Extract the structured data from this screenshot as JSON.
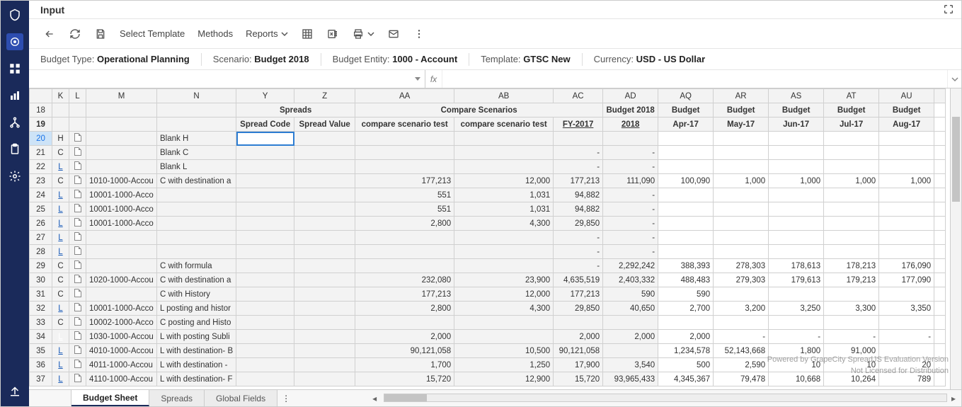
{
  "title": "Input",
  "toolbar": {
    "select_template": "Select Template",
    "methods": "Methods",
    "reports": "Reports"
  },
  "context": {
    "budget_type_label": "Budget Type:",
    "budget_type_value": "Operational Planning",
    "scenario_label": "Scenario:",
    "scenario_value": "Budget 2018",
    "entity_label": "Budget Entity:",
    "entity_value": "1000 - Account",
    "template_label": "Template:",
    "template_value": "GTSC New",
    "currency_label": "Currency:",
    "currency_value": "USD - US Dollar"
  },
  "formula": {
    "fx": "fx",
    "value": ""
  },
  "columns": [
    "K",
    "L",
    "M",
    "N",
    "Y",
    "Z",
    "AA",
    "AB",
    "AC",
    "AD",
    "AQ",
    "AR",
    "AS",
    "AT",
    "AU"
  ],
  "group_row": {
    "spreads": "Spreads",
    "compare": "Compare Scenarios",
    "budget_2018": "Budget 2018",
    "budget": "Budget"
  },
  "header_row": {
    "spread_code": "Spread Code",
    "spread_value": "Spread Value",
    "cst1": "compare scenario test",
    "cst2": "compare scenario test",
    "fy2017": "FY-2017",
    "y2018": "2018",
    "apr17": "Apr-17",
    "may17": "May-17",
    "jun17": "Jun-17",
    "jul17": "Jul-17",
    "aug17": "Aug-17"
  },
  "rows": [
    {
      "n": 20,
      "K": "H",
      "N": "Blank H"
    },
    {
      "n": 21,
      "K": "C",
      "N": "Blank C",
      "AC": "-",
      "AD": "-"
    },
    {
      "n": 22,
      "K": "L",
      "klink": true,
      "N": "Blank L",
      "AC": "-",
      "AD": "-"
    },
    {
      "n": 23,
      "K": "C",
      "M": "1010-1000-Accou",
      "N": "C with destination a",
      "AA": "177,213",
      "AB": "12,000",
      "AC": "177,213",
      "AD": "111,090",
      "AQ": "100,090",
      "AR": "1,000",
      "AS": "1,000",
      "AT": "1,000",
      "AU": "1,000"
    },
    {
      "n": 24,
      "K": "L",
      "klink": true,
      "M": "10001-1000-Acco",
      "AA": "551",
      "AB": "1,031",
      "AC": "94,882",
      "AD": "-"
    },
    {
      "n": 25,
      "K": "L",
      "klink": true,
      "M": "10001-1000-Acco",
      "AA": "551",
      "AB": "1,031",
      "AC": "94,882",
      "AD": "-"
    },
    {
      "n": 26,
      "K": "L",
      "klink": true,
      "M": "10001-1000-Acco",
      "AA": "2,800",
      "AB": "4,300",
      "AC": "29,850",
      "AD": "-"
    },
    {
      "n": 27,
      "K": "L",
      "klink": true,
      "AC": "-",
      "AD": "-"
    },
    {
      "n": 28,
      "K": "L",
      "klink": true,
      "AC": "-",
      "AD": "-"
    },
    {
      "n": 29,
      "K": "C",
      "N": "C with formula",
      "AC": "-",
      "AD": "2,292,242",
      "AQ": "388,393",
      "AR": "278,303",
      "AS": "178,613",
      "AT": "178,213",
      "AU": "176,090"
    },
    {
      "n": 30,
      "K": "C",
      "M": "1020-1000-Accou",
      "N": "C with destination a",
      "AA": "232,080",
      "AB": "23,900",
      "AC": "4,635,519",
      "AD": "2,403,332",
      "AQ": "488,483",
      "AR": "279,303",
      "AS": "179,613",
      "AT": "179,213",
      "AU": "177,090"
    },
    {
      "n": 31,
      "K": "C",
      "N": "C with History",
      "AA": "177,213",
      "AB": "12,000",
      "AC": "177,213",
      "AD": "590",
      "AQ": "590"
    },
    {
      "n": 32,
      "K": "L",
      "klink": true,
      "M": "10001-1000-Acco",
      "N": "L posting and histor",
      "AA": "2,800",
      "AB": "4,300",
      "AC": "29,850",
      "AD": "40,650",
      "AQ": "2,700",
      "AR": "3,200",
      "AS": "3,250",
      "AT": "3,300",
      "AU": "3,350"
    },
    {
      "n": 33,
      "K": "C",
      "M": "10002-1000-Acco",
      "N": "C posting and Histo"
    },
    {
      "n": 34,
      "K": "L",
      "khl": true,
      "M": "1030-1000-Accou",
      "N": "L with posting Subli",
      "AA": "2,000",
      "AC": "2,000",
      "AD": "2,000",
      "AQ": "2,000",
      "AR": "-",
      "AS": "-",
      "AT": "-",
      "AU": "-"
    },
    {
      "n": 35,
      "K": "L",
      "klink": true,
      "M": "4010-1000-Accou",
      "N": "L with destination- B",
      "AA": "90,121,058",
      "AB": "10,500",
      "AC": "90,121,058",
      "AQ": "1,234,578",
      "AR": "52,143,668",
      "AS": "1,800",
      "AT": "91,000"
    },
    {
      "n": 36,
      "K": "L",
      "klink": true,
      "M": "4011-1000-Accou",
      "N": "L with destination -",
      "AA": "1,700",
      "AB": "1,250",
      "AC": "17,900",
      "AD": "3,540",
      "AQ": "500",
      "AR": "2,590",
      "AS": "10",
      "AT": "10",
      "AU": "20"
    },
    {
      "n": 37,
      "K": "L",
      "klink": true,
      "M": "4110-1000-Accou",
      "N": "L with destination- F",
      "AA": "15,720",
      "AB": "12,900",
      "AC": "15,720",
      "AD": "93,965,433",
      "AQ": "4,345,367",
      "AR": "79,478",
      "AS": "10,668",
      "AT": "10,264",
      "AU": "789"
    }
  ],
  "tabs": {
    "budget_sheet": "Budget Sheet",
    "spreads": "Spreads",
    "global_fields": "Global Fields"
  },
  "watermark1": "Powered by GrapeCity SpreadJS Evaluation Version",
  "watermark2": "Not Licensed for Distribution"
}
